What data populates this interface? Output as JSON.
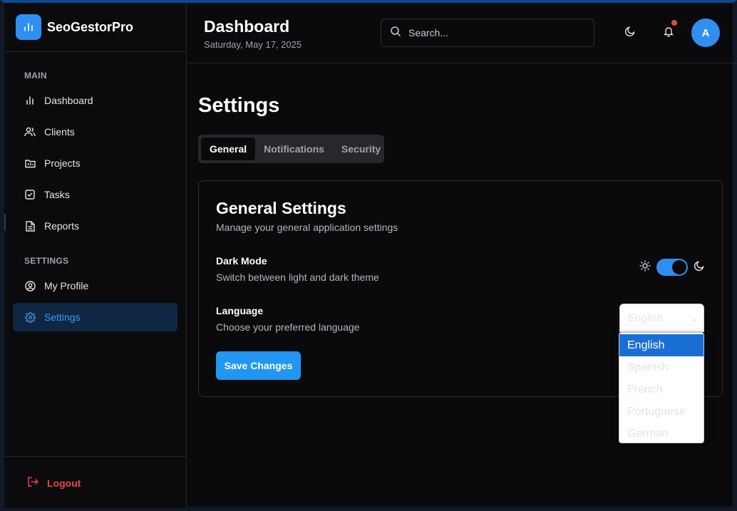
{
  "app": {
    "name": "SeoGestorPro"
  },
  "sidebar": {
    "main_label": "MAIN",
    "settings_label": "SETTINGS",
    "items": [
      {
        "label": "Dashboard",
        "icon": "bar-chart-icon"
      },
      {
        "label": "Clients",
        "icon": "users-icon"
      },
      {
        "label": "Projects",
        "icon": "folder-icon"
      },
      {
        "label": "Tasks",
        "icon": "check-square-icon"
      },
      {
        "label": "Reports",
        "icon": "file-text-icon"
      }
    ],
    "settings_items": [
      {
        "label": "My Profile",
        "icon": "user-circle-icon"
      },
      {
        "label": "Settings",
        "icon": "gear-icon",
        "active": true
      }
    ],
    "logout_label": "Logout"
  },
  "header": {
    "title": "Dashboard",
    "date": "Saturday, May 17, 2025",
    "search_placeholder": "Search...",
    "avatar_initial": "A"
  },
  "main": {
    "title": "Settings",
    "tabs": [
      {
        "label": "General",
        "active": true
      },
      {
        "label": "Notifications"
      },
      {
        "label": "Security"
      }
    ],
    "card": {
      "title": "General Settings",
      "subtitle": "Manage your general application settings",
      "dark_mode": {
        "title": "Dark Mode",
        "subtitle": "Switch between light and dark theme",
        "enabled": true
      },
      "language": {
        "title": "Language",
        "subtitle": "Choose your preferred language",
        "selected": "English",
        "options": [
          "English",
          "Spanish",
          "French",
          "Portuguese",
          "German"
        ]
      },
      "save_label": "Save Changes"
    }
  },
  "colors": {
    "accent": "#2f8ff0",
    "danger": "#ef4444",
    "background": "#0a0a0c",
    "active_nav_bg": "#0f2742"
  }
}
